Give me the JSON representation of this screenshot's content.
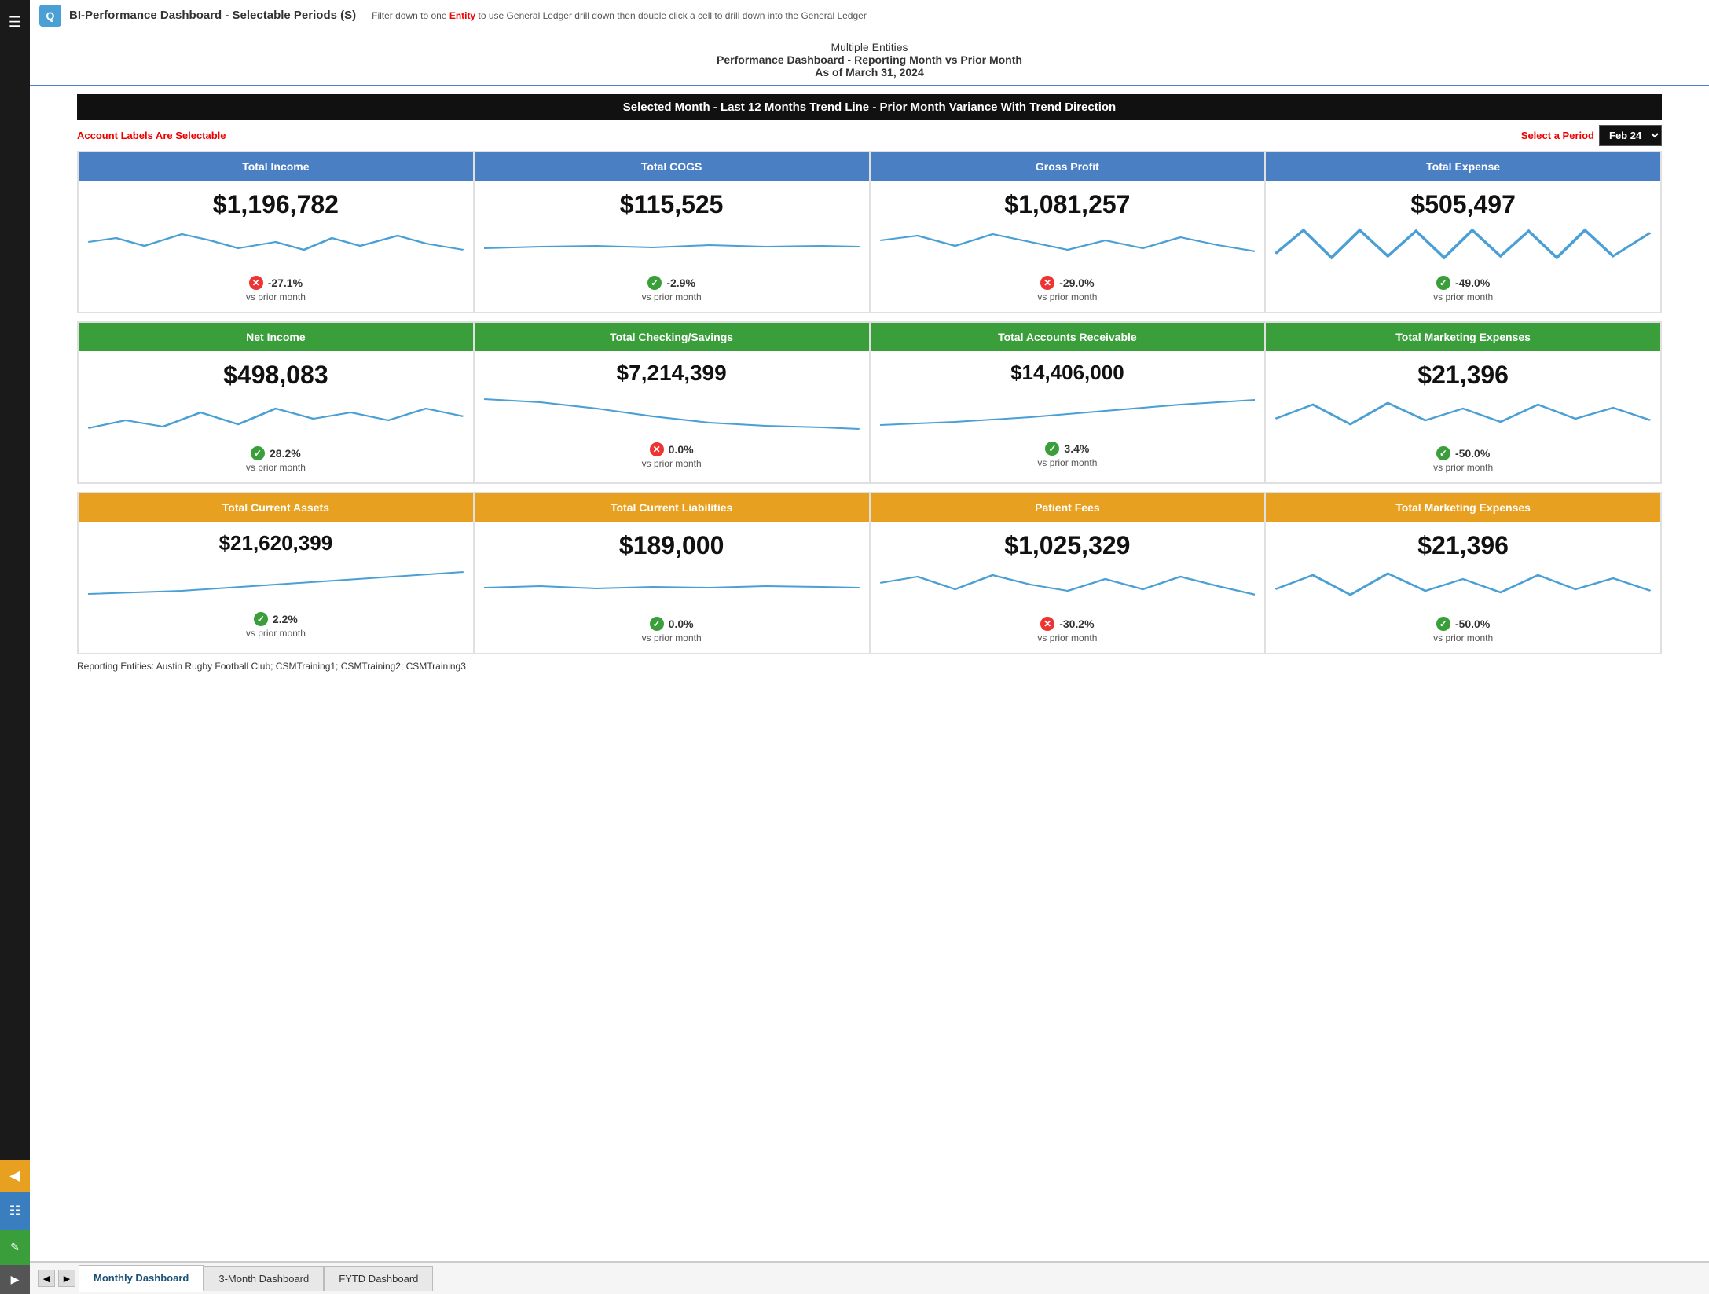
{
  "app": {
    "title": "BI-Performance Dashboard - Selectable Periods (S)",
    "filter_text": "Filter down to one",
    "filter_entity": "Entity",
    "filter_rest": "to use General Ledger drill down then double click a cell to drill down into the General Ledger"
  },
  "report": {
    "entity_line": "Multiple Entities",
    "title_line": "Performance Dashboard - Reporting Month vs Prior Month",
    "date_line": "As of March 31, 2024"
  },
  "section_title": "Selected Month - Last 12 Months Trend Line  - Prior Month Variance With Trend Direction",
  "controls": {
    "account_labels": "Account Labels Are Selectable",
    "select_period": "Select a Period",
    "period_value": "Feb 24"
  },
  "rows": [
    {
      "color": "blue",
      "cards": [
        {
          "label": "Total Income",
          "value": "$1,196,782",
          "variance_pct": "-27.1%",
          "variance_dir": "bad",
          "variance_label": "vs prior month",
          "chart": "zigzag_down"
        },
        {
          "label": "Total COGS",
          "value": "$115,525",
          "variance_pct": "-2.9%",
          "variance_dir": "good",
          "variance_label": "vs prior month",
          "chart": "flat_slight"
        },
        {
          "label": "Gross Profit",
          "value": "$1,081,257",
          "variance_pct": "-29.0%",
          "variance_dir": "bad",
          "variance_label": "vs prior month",
          "chart": "zigzag_down2"
        },
        {
          "label": "Total Expense",
          "value": "$505,497",
          "variance_pct": "-49.0%",
          "variance_dir": "good",
          "variance_label": "vs prior month",
          "chart": "zigzag_sharp"
        }
      ]
    },
    {
      "color": "green",
      "cards": [
        {
          "label": "Net Income",
          "value": "$498,083",
          "variance_pct": "28.2%",
          "variance_dir": "good",
          "variance_label": "vs prior month",
          "chart": "wave_up"
        },
        {
          "label": "Total Checking/Savings",
          "value": "$7,214,399",
          "variance_pct": "0.0%",
          "variance_dir": "bad",
          "variance_label": "vs prior month",
          "chart": "slope_down"
        },
        {
          "label": "Total Accounts Receivable",
          "value": "$14,406,000",
          "variance_pct": "3.4%",
          "variance_dir": "good",
          "variance_label": "vs prior month",
          "chart": "slope_up"
        },
        {
          "label": "Total Marketing Expenses",
          "value": "$21,396",
          "variance_pct": "-50.0%",
          "variance_dir": "good",
          "variance_label": "vs prior month",
          "chart": "zigzag_mid"
        }
      ]
    },
    {
      "color": "gold",
      "cards": [
        {
          "label": "Total Current Assets",
          "value": "$21,620,399",
          "variance_pct": "2.2%",
          "variance_dir": "good",
          "variance_label": "vs prior month",
          "chart": "slope_up2"
        },
        {
          "label": "Total Current Liabilities",
          "value": "$189,000",
          "variance_pct": "0.0%",
          "variance_dir": "good",
          "variance_label": "vs prior month",
          "chart": "flat_wave"
        },
        {
          "label": "Patient Fees",
          "value": "$1,025,329",
          "variance_pct": "-30.2%",
          "variance_dir": "bad",
          "variance_label": "vs prior month",
          "chart": "zigzag_down3"
        },
        {
          "label": "Total Marketing Expenses",
          "value": "$21,396",
          "variance_pct": "-50.0%",
          "variance_dir": "good",
          "variance_label": "vs prior month",
          "chart": "zigzag_mid2"
        }
      ]
    }
  ],
  "reporting_entities": "Reporting Entities: Austin Rugby Football Club; CSMTraining1; CSMTraining2; CSMTraining3",
  "tabs": [
    {
      "label": "Monthly Dashboard",
      "active": true
    },
    {
      "label": "3-Month Dashboard",
      "active": false
    },
    {
      "label": "FYTD Dashboard",
      "active": false
    }
  ],
  "sidebar": {
    "icons": [
      "≡",
      "◀",
      "▦",
      "📊"
    ]
  }
}
